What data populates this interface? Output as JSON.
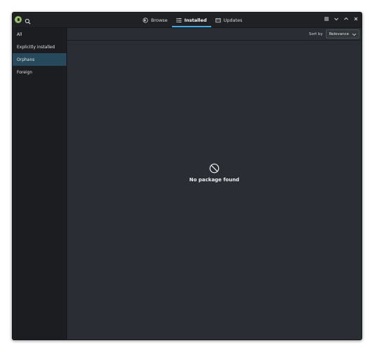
{
  "titlebar": {
    "tabs": [
      {
        "label": "Browse",
        "icon": "globe-icon"
      },
      {
        "label": "Installed",
        "icon": "list-icon",
        "active": true
      },
      {
        "label": "Updates",
        "icon": "updates-icon"
      }
    ],
    "controls": [
      "hamburger-menu-icon",
      "minimize-icon",
      "maximize-icon",
      "close-icon"
    ]
  },
  "sidebar": {
    "items": [
      {
        "label": "All"
      },
      {
        "label": "Explicitly installed"
      },
      {
        "label": "Orphans",
        "selected": true
      },
      {
        "label": "Foreign"
      }
    ]
  },
  "sort": {
    "label": "Sort by",
    "value": "Relevance"
  },
  "empty_state": {
    "icon": "no-entry-icon",
    "message": "No package found"
  },
  "colors": {
    "accent": "#3daee9",
    "selection": "#264a5c",
    "logo": "#96bf66"
  }
}
